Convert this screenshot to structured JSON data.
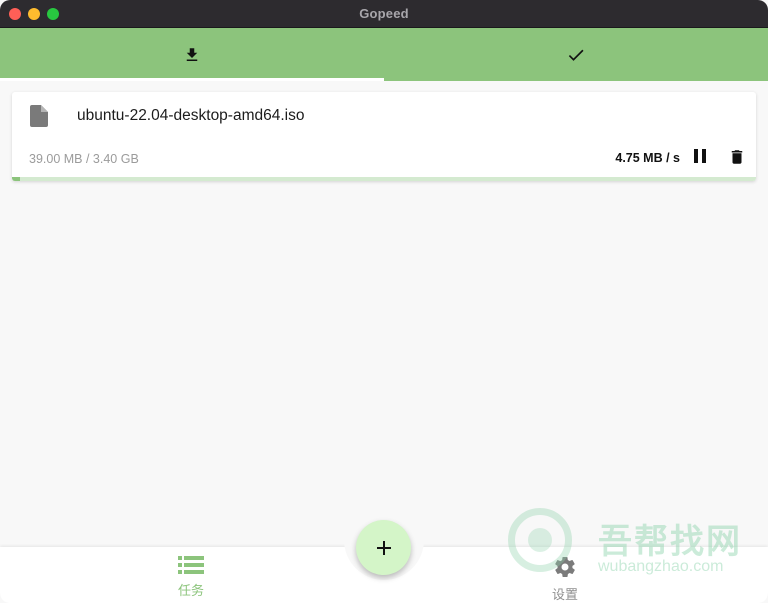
{
  "window": {
    "title": "Gopeed"
  },
  "tabs": [
    {
      "name": "downloading",
      "icon": "download-icon",
      "active": true
    },
    {
      "name": "completed",
      "icon": "check-icon",
      "active": false
    }
  ],
  "task": {
    "file_name": "ubuntu-22.04-desktop-amd64.iso",
    "size_text": "39.00 MB / 3.40 GB",
    "speed_text": "4.75 MB / s",
    "progress": 0.0112,
    "file_icon": "file-icon",
    "pause_icon": "pause-icon",
    "delete_icon": "trash-icon"
  },
  "bottom_nav": {
    "tasks_label": "任务",
    "settings_label": "设置",
    "tasks_icon": "list-icon",
    "settings_icon": "gear-icon",
    "add_icon": "plus-icon"
  },
  "watermark": {
    "text": "吾帮找网",
    "sub": "wubangzhao.com"
  },
  "colors": {
    "accent": "#8cc47c",
    "fab": "#d4f5c8",
    "titlebar": "#2d2b2f"
  }
}
